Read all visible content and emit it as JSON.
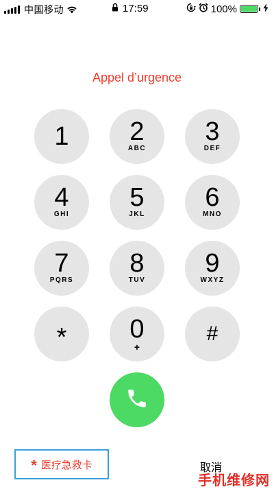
{
  "status_bar": {
    "carrier": "中国移动",
    "time": "17:59",
    "battery_percent": "100%",
    "battery_level": 1.0,
    "battery_color": "#4cd964"
  },
  "title": "Appel d’urgence",
  "keypad": [
    {
      "digit": "1",
      "letters": ""
    },
    {
      "digit": "2",
      "letters": "ABC"
    },
    {
      "digit": "3",
      "letters": "DEF"
    },
    {
      "digit": "4",
      "letters": "GHI"
    },
    {
      "digit": "5",
      "letters": "JKL"
    },
    {
      "digit": "6",
      "letters": "MNO"
    },
    {
      "digit": "7",
      "letters": "PQRS"
    },
    {
      "digit": "8",
      "letters": "TUV"
    },
    {
      "digit": "9",
      "letters": "WXYZ"
    },
    {
      "digit": "*",
      "letters": ""
    },
    {
      "digit": "0",
      "letters": "+"
    },
    {
      "digit": "#",
      "letters": ""
    }
  ],
  "call_button": {
    "icon": "phone-icon",
    "color": "#4cd964"
  },
  "medical_card": {
    "star": "*",
    "label": "医疗急救卡"
  },
  "cancel_label": "取消",
  "watermark": "手机维修网",
  "accent_color": "#ec3f2f"
}
